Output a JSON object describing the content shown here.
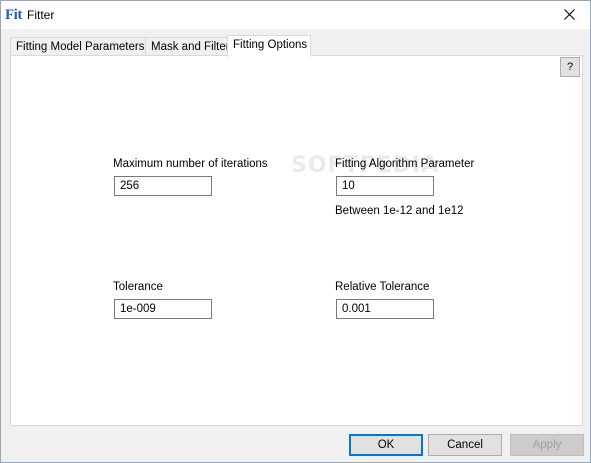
{
  "window": {
    "icon_text": "Fit",
    "title": "Fitter"
  },
  "tabs": [
    {
      "label": "Fitting Model  Parameters"
    },
    {
      "label": "Mask and Filter"
    },
    {
      "label": "Fitting Options",
      "active": true
    }
  ],
  "help_button": "?",
  "fields": {
    "max_iterations": {
      "label": "Maximum number of iterations",
      "value": "256"
    },
    "algorithm_param": {
      "label": "Fitting Algorithm Parameter",
      "value": "10",
      "hint": "Between 1e-12 and 1e12"
    },
    "tolerance": {
      "label": "Tolerance",
      "value": "1e-009"
    },
    "relative_tolerance": {
      "label": "Relative Tolerance",
      "value": "0.001"
    }
  },
  "buttons": {
    "ok": "OK",
    "cancel": "Cancel",
    "apply": "Apply"
  },
  "watermark": "SOFTPEDIA",
  "colors": {
    "accent": "#0078d7",
    "icon_blue": "#1f5fb4"
  }
}
